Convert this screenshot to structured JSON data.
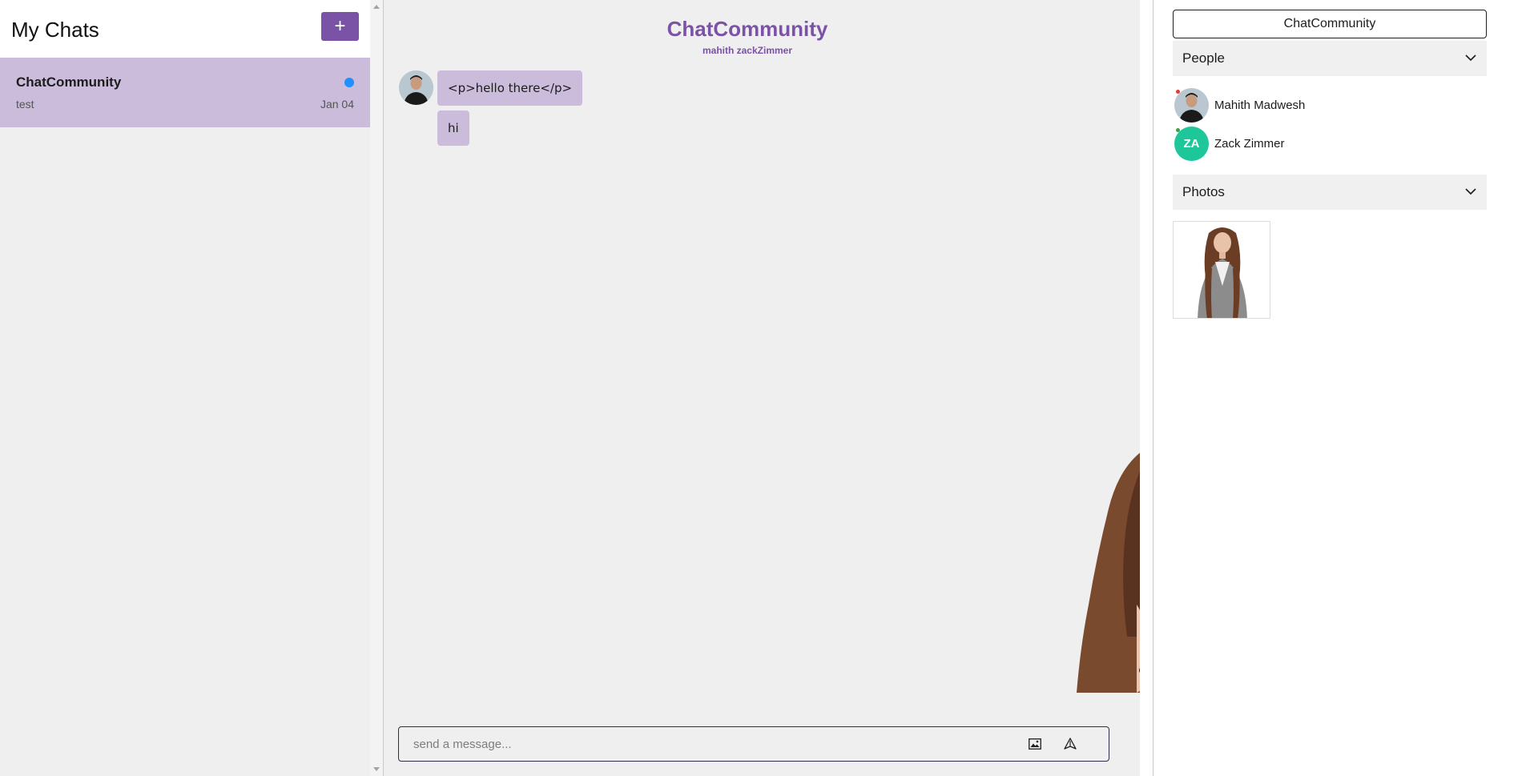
{
  "left": {
    "title": "My Chats",
    "add_label": "+",
    "chats": [
      {
        "name": "ChatCommunity",
        "last_message": "test",
        "date": "Jan 04",
        "unread": true
      }
    ]
  },
  "center": {
    "title": "ChatCommunity",
    "subtitle": "mahith zackZimmer",
    "messages": [
      {
        "text": "<p>hello there</p>"
      },
      {
        "text": "hi"
      }
    ],
    "input_placeholder": "send a message...",
    "icons": {
      "image": "image-icon",
      "send": "send-icon"
    }
  },
  "right": {
    "title": "ChatCommunity",
    "people_label": "People",
    "people": [
      {
        "name": "Mahith Madwesh",
        "initials": "",
        "status_color": "#e53935"
      },
      {
        "name": "Zack Zimmer",
        "initials": "ZA",
        "status_color": "#43a047"
      }
    ],
    "photos_label": "Photos"
  },
  "colors": {
    "accent": "#7a52a6",
    "active_chat_bg": "#cbbcdc",
    "unread_dot": "#1e90ff",
    "za_avatar": "#1ec79a"
  }
}
